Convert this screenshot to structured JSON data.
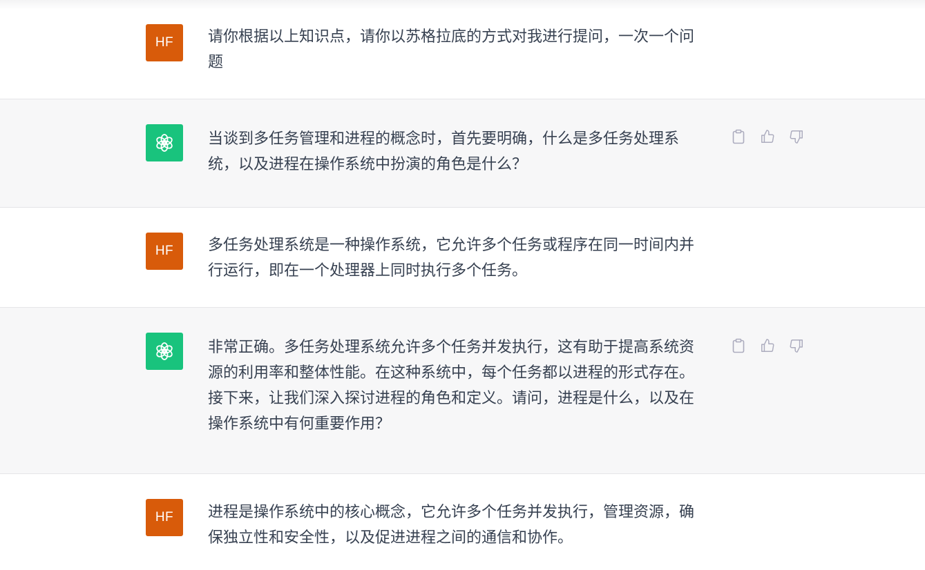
{
  "messages": [
    {
      "role": "user",
      "avatar": "HF",
      "text": "请你根据以上知识点，请你以苏格拉底的方式对我进行提问，一次一个问题"
    },
    {
      "role": "assistant",
      "avatar_icon": "openai-logo-icon",
      "text": "当谈到多任务管理和进程的概念时，首先要明确，什么是多任务处理系统，以及进程在操作系统中扮演的角色是什么？"
    },
    {
      "role": "user",
      "avatar": "HF",
      "text": "多任务处理系统是一种操作系统，它允许多个任务或程序在同一时间内并行运行，即在一个处理器上同时执行多个任务。"
    },
    {
      "role": "assistant",
      "avatar_icon": "openai-logo-icon",
      "text": "非常正确。多任务处理系统允许多个任务并发执行，这有助于提高系统资源的利用率和整体性能。在这种系统中，每个任务都以进程的形式存在。接下来，让我们深入探讨进程的角色和定义。请问，进程是什么，以及在操作系统中有何重要作用？"
    },
    {
      "role": "user",
      "avatar": "HF",
      "text": "进程是操作系统中的核心概念，它允许多个任务并发执行，管理资源，确保独立性和安全性，以及促进进程之间的通信和协作。"
    }
  ],
  "action_icons": [
    "clipboard-icon",
    "thumbs-up-icon",
    "thumbs-down-icon"
  ],
  "colors": {
    "user_avatar": "#d85b0a",
    "assistant_avatar": "#19c37d",
    "assistant_bg": "#f7f7f8",
    "text": "#374151",
    "icon": "#acacbe"
  }
}
